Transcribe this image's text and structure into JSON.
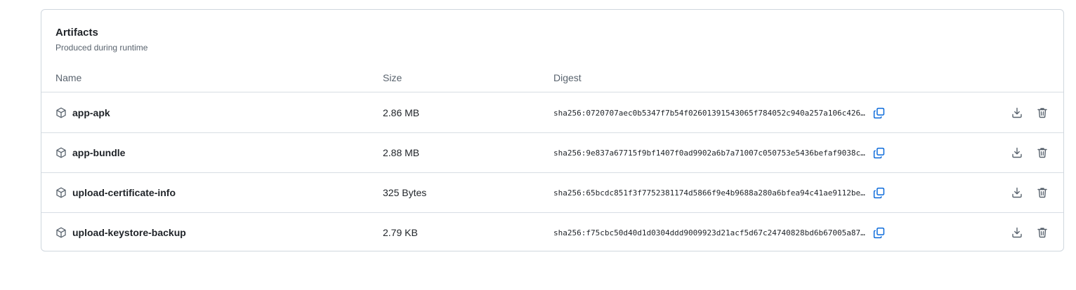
{
  "artifacts_panel": {
    "title": "Artifacts",
    "subtitle": "Produced during runtime",
    "columns": {
      "name": "Name",
      "size": "Size",
      "digest": "Digest"
    },
    "rows": [
      {
        "name": "app-apk",
        "size": "2.86 MB",
        "digest": "sha256:0720707aec0b5347f7b54f02601391543065f784052c940a257a106c426..."
      },
      {
        "name": "app-bundle",
        "size": "2.88 MB",
        "digest": "sha256:9e837a67715f9bf1407f0ad9902a6b7a71007c050753e5436befaf9038c..."
      },
      {
        "name": "upload-certificate-info",
        "size": "325 Bytes",
        "digest": "sha256:65bcdc851f3f7752381174d5866f9e4b9688a280a6bfea94c41ae9112be..."
      },
      {
        "name": "upload-keystore-backup",
        "size": "2.79 KB",
        "digest": "sha256:f75cbc50d40d1d0304ddd9009923d21acf5d67c24740828bd6b67005a87..."
      }
    ],
    "icons": {
      "artifact": "package-icon",
      "copy": "copy-icon",
      "download": "download-icon",
      "delete": "trash-icon"
    },
    "colors": {
      "accent": "#0969da",
      "muted_icon": "#59636e",
      "border": "#d0d7de"
    }
  }
}
